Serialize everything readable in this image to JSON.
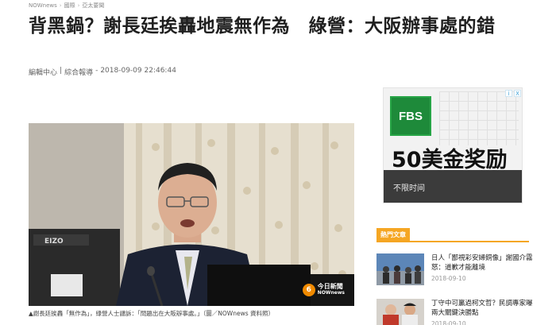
{
  "breadcrumb": [
    "NOWnews",
    "國際",
    "亞太要聞"
  ],
  "headline": "背黑鍋？謝長廷挨轟地震無作為　綠營：大阪辦事處的錯",
  "byline": {
    "author": "編輯中心",
    "separator": "|",
    "source": "綜合報導",
    "dash": "-",
    "datetime": "2018-09-09 22:46:44"
  },
  "photo": {
    "watermark_icon": "6",
    "watermark_top": "今日新聞",
    "watermark_bottom": "NOWnews",
    "monitor_brand": "EIZO",
    "caption": "▲謝長廷挨轟「無作為」，綠營人士譴訴：「問題出在大阪辦事處。」（圖／NOWnews 資料照）"
  },
  "ad": {
    "logo": "FBS",
    "title": "50美金奖励",
    "subtitle": "不限时间",
    "choices_icon": "i",
    "close_icon": "X"
  },
  "hot": {
    "header": "熱門文章",
    "articles": [
      {
        "title": "日人「鄙視彩安婦銅像」謝國介霧怒：道歉才能離境",
        "date": "2018-09-10"
      },
      {
        "title": "丁守中可贏過柯文哲？民調專家曝兩大關鍵決勝點",
        "date": "2018-09-10"
      }
    ]
  },
  "colors": {
    "accent": "#f5a623",
    "ad_green": "#1e8a3a",
    "ad_dark": "#3b3b3b"
  }
}
